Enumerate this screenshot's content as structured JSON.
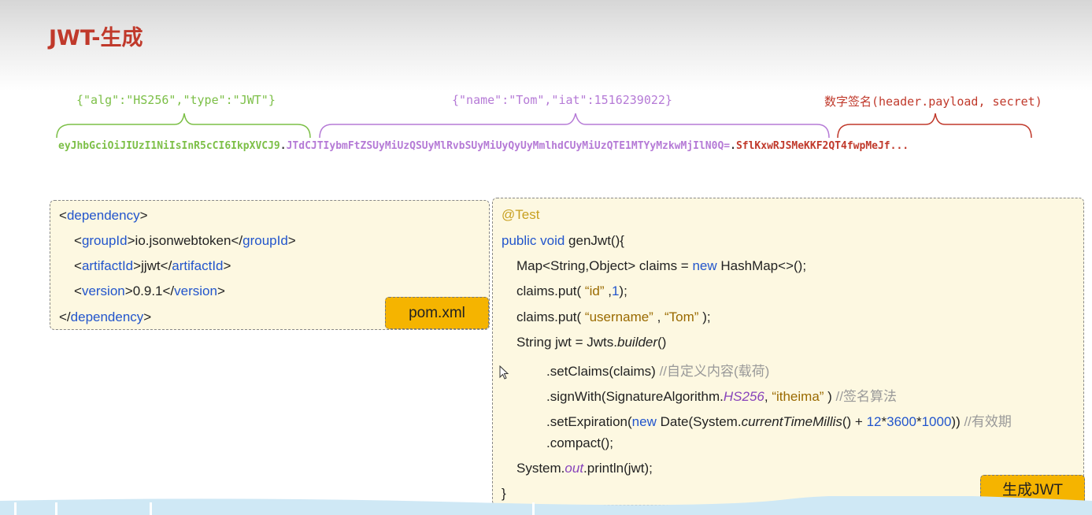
{
  "slide": {
    "title": "JWT-生成"
  },
  "jwt": {
    "header_json": "{\"alg\":\"HS256\",\"type\":\"JWT\"}",
    "payload_json": "{\"name\":\"Tom\",\"iat\":1516239022}",
    "signature_desc": "数字签名(header.payload, secret)",
    "token_header": "eyJhbGciOiJIUzI1NiIsInR5cCI6IkpXVCJ9",
    "token_payload": "JTdCJTIybmFtZSUyMiUzQSUyMlRvbSUyMiUyQyUyMmlhdCUyMiUzQTE1MTYyMzkwMjIlN0Q=",
    "token_signature": "SflKxwRJSMeKKF2QT4fwpMeJf...",
    "dot": ".",
    "colors": {
      "header": "#7cbf47",
      "payload": "#b57ad6",
      "signature": "#c0392b"
    }
  },
  "pom": {
    "badge": "pom.xml",
    "lt": "<",
    "gt": ">",
    "ltslash": "</",
    "t_dependency": "dependency",
    "t_groupId": "groupId",
    "v_groupId": "io.jsonwebtoken",
    "t_artifactId": "artifactId",
    "v_artifactId": "jjwt",
    "t_version": "version",
    "v_version": "0.9.1"
  },
  "code": {
    "badge": "生成JWT",
    "annotation": "@Test",
    "l2_kw": "public void",
    "l2_rest": " genJwt(){",
    "l3_a": "Map<String,Object> claims = ",
    "l3_kw": "new",
    "l3_b": " HashMap<>();",
    "l4_a": "claims.put( ",
    "l4_str": "“id”",
    "l4_b": " ,",
    "l4_num": "1",
    "l4_c": ");",
    "l5_a": "claims.put( ",
    "l5_str1": "“username”",
    "l5_b": " , ",
    "l5_str2": "“Tom”",
    "l5_c": " );",
    "l6_a": "String jwt = Jwts.",
    "l6_it": "builder",
    "l6_b": "()",
    "l7_a": ".setClaims(claims) ",
    "l7_cm": "//自定义内容(载荷)",
    "l8_a": ".signWith(SignatureAlgorithm.",
    "l8_it": "HS256",
    "l8_b": ",  ",
    "l8_str": "“itheima”",
    "l8_c": " ) ",
    "l8_cm": "//签名算法",
    "l9_a": ".setExpiration(",
    "l9_kw": "new",
    "l9_b": " Date(System.",
    "l9_it": "currentTimeMillis",
    "l9_c": "() + ",
    "l9_n1": "12",
    "l9_d": "*",
    "l9_n2": "3600",
    "l9_e": "*",
    "l9_n3": "1000",
    "l9_f": ")) ",
    "l9_cm": "//有效期",
    "l10": ".compact();",
    "l11_a": "System.",
    "l11_it": "out",
    "l11_b": ".println(jwt);",
    "l12": "}"
  }
}
